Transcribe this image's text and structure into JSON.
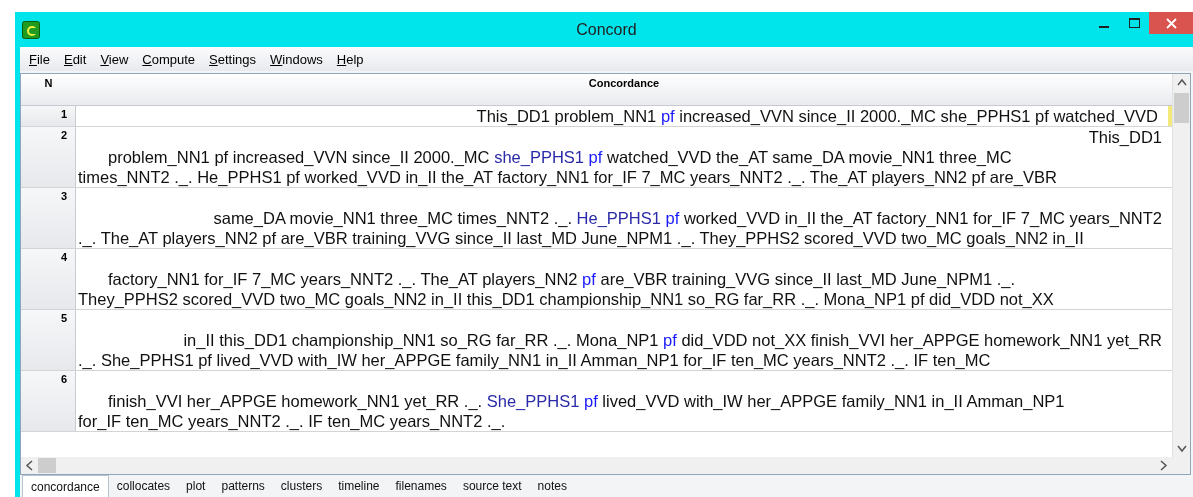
{
  "window": {
    "title": "Concord"
  },
  "menu": [
    {
      "label": "File"
    },
    {
      "label": "Edit"
    },
    {
      "label": "View"
    },
    {
      "label": "Compute"
    },
    {
      "label": "Settings"
    },
    {
      "label": "Windows"
    },
    {
      "label": "Help"
    }
  ],
  "table": {
    "columns": [
      "N",
      "Concordance"
    ],
    "rows": [
      {
        "n": "1",
        "lines": [
          {
            "kind": "right",
            "parts": [
              {
                "kind": "text",
                "text": "This_DD1 problem_NN1 "
              },
              {
                "kind": "hit",
                "text": "pf"
              },
              {
                "kind": "text",
                "text": " increased_VVN since_II 2000._MC she_PPHS1 pf watched_VVD"
              }
            ]
          }
        ]
      },
      {
        "n": "2",
        "lines": [
          {
            "kind": "right",
            "parts": [
              {
                "kind": "text",
                "text": "This_DD1"
              }
            ]
          },
          {
            "kind": "indent",
            "parts": [
              {
                "kind": "text",
                "text": "problem_NN1 pf increased_VVN since_II 2000._MC "
              },
              {
                "kind": "node",
                "text": "she_PPHS1 "
              },
              {
                "kind": "hit",
                "text": "pf"
              },
              {
                "kind": "text",
                "text": " watched_VVD the_AT same_DA movie_NN1 three_MC"
              }
            ]
          },
          {
            "kind": "plain",
            "parts": [
              {
                "kind": "text",
                "text": "times_NNT2 ._. He_PPHS1 pf worked_VVD in_II the_AT factory_NN1 for_IF 7_MC years_NNT2 ._. The_AT players_NN2 pf are_VBR"
              }
            ]
          }
        ]
      },
      {
        "n": "3",
        "lines": [
          {
            "kind": "blank"
          },
          {
            "kind": "right",
            "parts": [
              {
                "kind": "text",
                "text": "same_DA movie_NN1 three_MC times_NNT2 ._. "
              },
              {
                "kind": "node",
                "text": "He_PPHS1 "
              },
              {
                "kind": "hit",
                "text": "pf"
              },
              {
                "kind": "text",
                "text": " worked_VVD in_II the_AT factory_NN1 for_IF 7_MC years_NNT2"
              }
            ]
          },
          {
            "kind": "plain",
            "parts": [
              {
                "kind": "text",
                "text": "._. The_AT players_NN2 pf are_VBR training_VVG since_II last_MD June_NPM1 ._. They_PPHS2 scored_VVD two_MC goals_NN2 in_II"
              }
            ]
          }
        ]
      },
      {
        "n": "4",
        "lines": [
          {
            "kind": "blank"
          },
          {
            "kind": "indent",
            "parts": [
              {
                "kind": "text",
                "text": "factory_NN1 for_IF 7_MC years_NNT2 ._. The_AT players_NN2 "
              },
              {
                "kind": "hit",
                "text": "pf"
              },
              {
                "kind": "text",
                "text": " are_VBR training_VVG since_II last_MD June_NPM1 ._."
              }
            ]
          },
          {
            "kind": "plain",
            "parts": [
              {
                "kind": "text",
                "text": "They_PPHS2 scored_VVD two_MC goals_NN2 in_II this_DD1 championship_NN1 so_RG far_RR ._. Mona_NP1 pf did_VDD not_XX"
              }
            ]
          }
        ]
      },
      {
        "n": "5",
        "lines": [
          {
            "kind": "blank"
          },
          {
            "kind": "right",
            "parts": [
              {
                "kind": "text",
                "text": "in_II this_DD1 championship_NN1 so_RG far_RR ._. Mona_NP1 "
              },
              {
                "kind": "hit",
                "text": "pf"
              },
              {
                "kind": "text",
                "text": " did_VDD not_XX finish_VVI her_APPGE homework_NN1 yet_RR"
              }
            ]
          },
          {
            "kind": "plain",
            "parts": [
              {
                "kind": "text",
                "text": "._. She_PPHS1 pf lived_VVD with_IW her_APPGE family_NN1 in_II Amman_NP1 for_IF ten_MC years_NNT2 ._. IF ten_MC"
              }
            ]
          }
        ]
      },
      {
        "n": "6",
        "lines": [
          {
            "kind": "blank"
          },
          {
            "kind": "indent",
            "parts": [
              {
                "kind": "text",
                "text": "finish_VVI her_APPGE homework_NN1 yet_RR ._. "
              },
              {
                "kind": "node",
                "text": "She_PPHS1 "
              },
              {
                "kind": "hit",
                "text": "pf"
              },
              {
                "kind": "text",
                "text": " lived_VVD with_IW her_APPGE family_NN1 in_II Amman_NP1"
              }
            ]
          },
          {
            "kind": "plain",
            "parts": [
              {
                "kind": "text",
                "text": "for_IF ten_MC years_NNT2 ._. IF ten_MC years_NNT2 ._."
              }
            ]
          }
        ]
      }
    ]
  },
  "tabs": [
    {
      "label": "concordance",
      "selected": true
    },
    {
      "label": "collocates",
      "selected": false
    },
    {
      "label": "plot",
      "selected": false
    },
    {
      "label": "patterns",
      "selected": false
    },
    {
      "label": "clusters",
      "selected": false
    },
    {
      "label": "timeline",
      "selected": false
    },
    {
      "label": "filenames",
      "selected": false
    },
    {
      "label": "source text",
      "selected": false
    },
    {
      "label": "notes",
      "selected": false
    }
  ]
}
